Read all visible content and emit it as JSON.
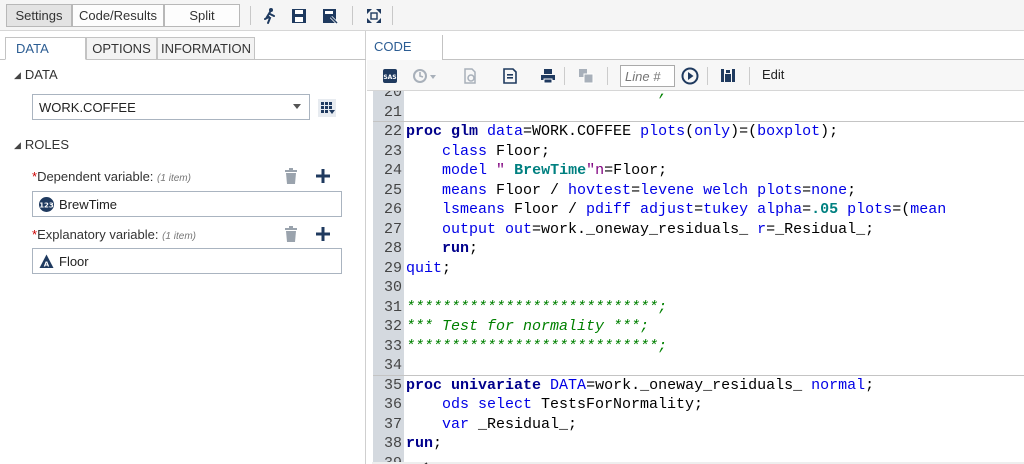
{
  "top_toolbar": {
    "buttons": [
      "Settings",
      "Code/Results",
      "Split"
    ],
    "icons": [
      "run-icon",
      "save-icon",
      "save-as-icon",
      "maximize-icon"
    ]
  },
  "left_panel": {
    "tabs": [
      "DATA",
      "OPTIONS",
      "INFORMATION"
    ],
    "data_section": "DATA",
    "dataset": "WORK.COFFEE",
    "roles_section": "ROLES",
    "dependent": {
      "label": "Dependent variable:",
      "count": "(1 item)",
      "value": "BrewTime"
    },
    "explanatory": {
      "label": "Explanatory variable:",
      "count": "(1 item)",
      "value": "Floor"
    }
  },
  "right_panel": {
    "tab": "CODE",
    "toolbar": {
      "line_placeholder": "Line #",
      "edit_label": "Edit"
    }
  },
  "code_lines": [
    {
      "n": "20",
      "tokens": [
        {
          "c": "t-cm",
          "t": "****************************;"
        }
      ]
    },
    {
      "n": "21",
      "tokens": []
    },
    {
      "n": "22",
      "tokens": [
        {
          "c": "t-kw",
          "t": "proc glm"
        },
        {
          "c": "t-txt",
          "t": " "
        },
        {
          "c": "t-kw2",
          "t": "data"
        },
        {
          "c": "t-txt",
          "t": "=WORK.COFFEE "
        },
        {
          "c": "t-kw2",
          "t": "plots"
        },
        {
          "c": "t-txt",
          "t": "("
        },
        {
          "c": "t-kw2",
          "t": "only"
        },
        {
          "c": "t-txt",
          "t": ")=("
        },
        {
          "c": "t-kw2",
          "t": "boxplot"
        },
        {
          "c": "t-txt",
          "t": ");"
        }
      ]
    },
    {
      "n": "23",
      "tokens": [
        {
          "c": "t-txt",
          "t": "    "
        },
        {
          "c": "t-kw2",
          "t": "class"
        },
        {
          "c": "t-txt",
          "t": " Floor;"
        }
      ]
    },
    {
      "n": "24",
      "tokens": [
        {
          "c": "t-txt",
          "t": "    "
        },
        {
          "c": "t-kw2",
          "t": "model"
        },
        {
          "c": "t-txt",
          "t": " "
        },
        {
          "c": "t-str-b",
          "t": "\" BrewTime\"n"
        },
        {
          "c": "t-txt",
          "t": "=Floor;"
        }
      ]
    },
    {
      "n": "25",
      "tokens": [
        {
          "c": "t-txt",
          "t": "    "
        },
        {
          "c": "t-kw2",
          "t": "means"
        },
        {
          "c": "t-txt",
          "t": " Floor / "
        },
        {
          "c": "t-kw2",
          "t": "hovtest"
        },
        {
          "c": "t-txt",
          "t": "="
        },
        {
          "c": "t-kw2",
          "t": "levene welch plots"
        },
        {
          "c": "t-txt",
          "t": "="
        },
        {
          "c": "t-kw2",
          "t": "none"
        },
        {
          "c": "t-txt",
          "t": ";"
        }
      ]
    },
    {
      "n": "26",
      "tokens": [
        {
          "c": "t-txt",
          "t": "    "
        },
        {
          "c": "t-kw2",
          "t": "lsmeans"
        },
        {
          "c": "t-txt",
          "t": " Floor / "
        },
        {
          "c": "t-kw2",
          "t": "pdiff adjust"
        },
        {
          "c": "t-txt",
          "t": "="
        },
        {
          "c": "t-kw2",
          "t": "tukey alpha"
        },
        {
          "c": "t-txt",
          "t": "="
        },
        {
          "c": "t-num",
          "t": ".05"
        },
        {
          "c": "t-txt",
          "t": " "
        },
        {
          "c": "t-kw2",
          "t": "plots"
        },
        {
          "c": "t-txt",
          "t": "=("
        },
        {
          "c": "t-kw2",
          "t": "mean"
        }
      ]
    },
    {
      "n": "27",
      "tokens": [
        {
          "c": "t-txt",
          "t": "    "
        },
        {
          "c": "t-kw2",
          "t": "output out"
        },
        {
          "c": "t-txt",
          "t": "=work._oneway_residuals_ "
        },
        {
          "c": "t-kw2",
          "t": "r"
        },
        {
          "c": "t-txt",
          "t": "=_Residual_;"
        }
      ]
    },
    {
      "n": "28",
      "tokens": [
        {
          "c": "t-txt",
          "t": "    "
        },
        {
          "c": "t-kw",
          "t": "run"
        },
        {
          "c": "t-txt",
          "t": ";"
        }
      ]
    },
    {
      "n": "29",
      "tokens": [
        {
          "c": "t-kw2",
          "t": "quit"
        },
        {
          "c": "t-txt",
          "t": ";"
        }
      ]
    },
    {
      "n": "30",
      "tokens": []
    },
    {
      "n": "31",
      "tokens": [
        {
          "c": "t-cm",
          "t": "****************************;"
        }
      ]
    },
    {
      "n": "32",
      "tokens": [
        {
          "c": "t-cm",
          "t": "*** Test for normality ***;"
        }
      ]
    },
    {
      "n": "33",
      "tokens": [
        {
          "c": "t-cm",
          "t": "****************************;"
        }
      ]
    },
    {
      "n": "34",
      "tokens": []
    },
    {
      "n": "35",
      "tokens": [
        {
          "c": "t-kw",
          "t": "proc univariate"
        },
        {
          "c": "t-txt",
          "t": " "
        },
        {
          "c": "t-kw2",
          "t": "DATA"
        },
        {
          "c": "t-txt",
          "t": "=work._oneway_residuals_ "
        },
        {
          "c": "t-kw2",
          "t": "normal"
        },
        {
          "c": "t-txt",
          "t": ";"
        }
      ]
    },
    {
      "n": "36",
      "tokens": [
        {
          "c": "t-txt",
          "t": "    "
        },
        {
          "c": "t-kw2",
          "t": "ods select"
        },
        {
          "c": "t-txt",
          "t": " TestsForNormality;"
        }
      ]
    },
    {
      "n": "37",
      "tokens": [
        {
          "c": "t-txt",
          "t": "    "
        },
        {
          "c": "t-kw2",
          "t": "var"
        },
        {
          "c": "t-txt",
          "t": " _Residual_;"
        }
      ]
    },
    {
      "n": "38",
      "tokens": [
        {
          "c": "t-kw",
          "t": "run"
        },
        {
          "c": "t-txt",
          "t": ";"
        }
      ]
    },
    {
      "n": "39",
      "tokens": []
    }
  ]
}
